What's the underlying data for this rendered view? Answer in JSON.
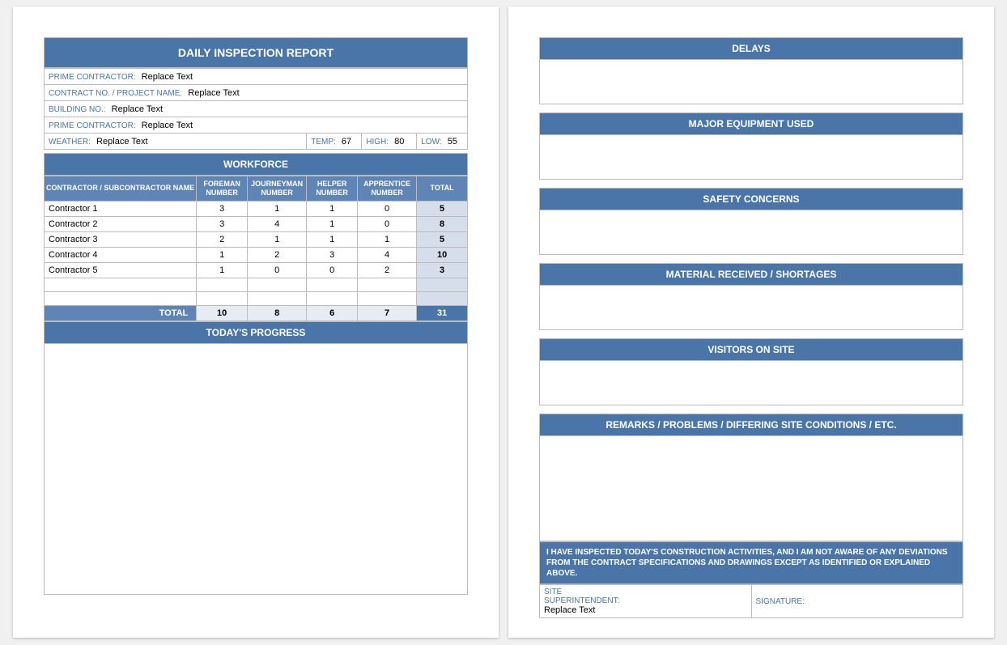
{
  "report": {
    "title": "DAILY INSPECTION REPORT",
    "info": {
      "prime1_label": "PRIME CONTRACTOR:",
      "prime1_value": "Replace Text",
      "contract_label": "CONTRACT NO. / PROJECT NAME:",
      "contract_value": "Replace Text",
      "building_label": "BUILDING NO.:",
      "building_value": "Replace Text",
      "prime2_label": "PRIME CONTRACTOR:",
      "prime2_value": "Replace Text",
      "weather_label": "WEATHER:",
      "weather_value": "Replace Text",
      "temp_label": "TEMP:",
      "temp_value": "67",
      "high_label": "HIGH:",
      "high_value": "80",
      "low_label": "LOW:",
      "low_value": "55"
    },
    "workforce": {
      "header": "WORKFORCE",
      "cols": {
        "c0": "CONTRACTOR / SUBCONTRACTOR NAME",
        "c1": "FOREMAN NUMBER",
        "c2": "JOURNEYMAN NUMBER",
        "c3": "HELPER NUMBER",
        "c4": "APPRENTICE NUMBER",
        "c5": "TOTAL"
      },
      "rows": [
        {
          "name": "Contractor 1",
          "f": "3",
          "j": "1",
          "h": "1",
          "a": "0",
          "t": "5"
        },
        {
          "name": "Contractor 2",
          "f": "3",
          "j": "4",
          "h": "1",
          "a": "0",
          "t": "8"
        },
        {
          "name": "Contractor 3",
          "f": "2",
          "j": "1",
          "h": "1",
          "a": "1",
          "t": "5"
        },
        {
          "name": "Contractor 4",
          "f": "1",
          "j": "2",
          "h": "3",
          "a": "4",
          "t": "10"
        },
        {
          "name": "Contractor 5",
          "f": "1",
          "j": "0",
          "h": "0",
          "a": "2",
          "t": "3"
        }
      ],
      "totals": {
        "label": "TOTAL",
        "f": "10",
        "j": "8",
        "h": "6",
        "a": "7",
        "t": "31"
      }
    },
    "progress_header": "TODAY'S PROGRESS",
    "sections": {
      "delays": "DELAYS",
      "equipment": "MAJOR EQUIPMENT USED",
      "safety": "SAFETY CONCERNS",
      "material": "MATERIAL RECEIVED / SHORTAGES",
      "visitors": "VISITORS ON SITE",
      "remarks": "REMARKS / PROBLEMS / DIFFERING SITE CONDITIONS / ETC."
    },
    "cert_text": "I HAVE INSPECTED TODAY'S CONSTRUCTION ACTIVITIES, AND I AM NOT AWARE OF ANY DEVIATIONS FROM THE CONTRACT SPECIFICATIONS AND DRAWINGS EXCEPT AS IDENTIFIED OR EXPLAINED ABOVE.",
    "sig": {
      "super_label": "SITE SUPERINTENDENT:",
      "super_value": "Replace Text",
      "sign_label": "SIGNATURE:"
    }
  },
  "chart_data": {
    "type": "table",
    "title": "Workforce",
    "columns": [
      "Contractor",
      "Foreman",
      "Journeyman",
      "Helper",
      "Apprentice",
      "Total"
    ],
    "rows": [
      [
        "Contractor 1",
        3,
        1,
        1,
        0,
        5
      ],
      [
        "Contractor 2",
        3,
        4,
        1,
        0,
        8
      ],
      [
        "Contractor 3",
        2,
        1,
        1,
        1,
        5
      ],
      [
        "Contractor 4",
        1,
        2,
        3,
        4,
        10
      ],
      [
        "Contractor 5",
        1,
        0,
        0,
        2,
        3
      ]
    ],
    "totals": [
      "TOTAL",
      10,
      8,
      6,
      7,
      31
    ]
  }
}
